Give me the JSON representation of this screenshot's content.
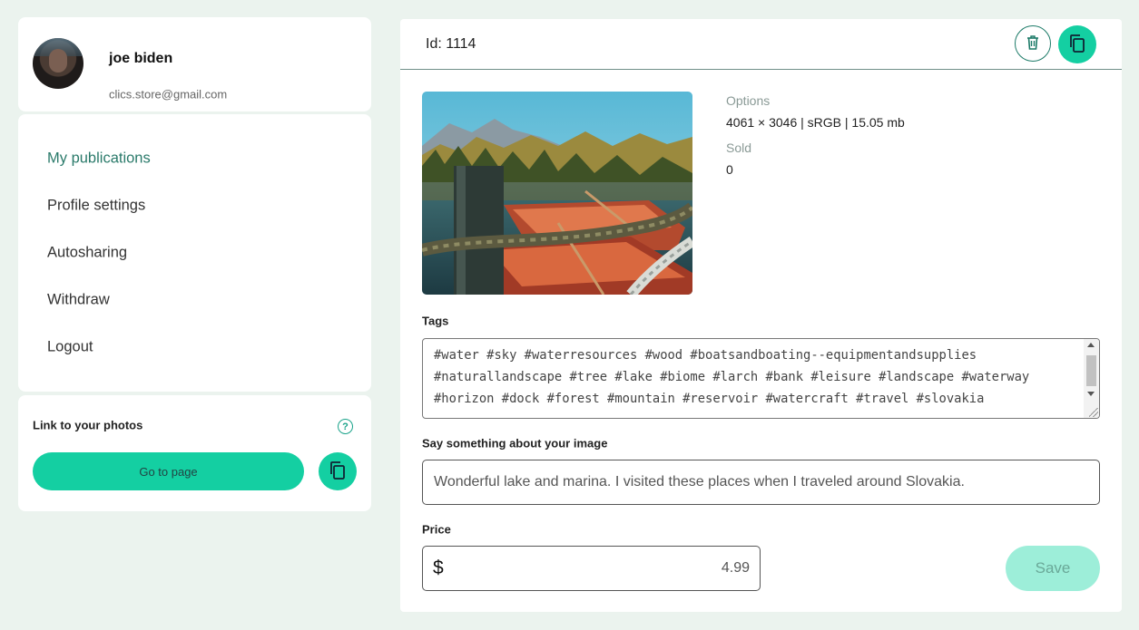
{
  "profile": {
    "name": "joe biden",
    "email": "clics.store@gmail.com"
  },
  "nav": {
    "items": [
      {
        "label": "My publications",
        "active": true
      },
      {
        "label": "Profile settings",
        "active": false
      },
      {
        "label": "Autosharing",
        "active": false
      },
      {
        "label": "Withdraw",
        "active": false
      },
      {
        "label": "Logout",
        "active": false
      }
    ]
  },
  "link_card": {
    "title": "Link to your photos",
    "help_icon": "?",
    "go_button": "Go to page",
    "copy_icon": "copy-icon"
  },
  "publication": {
    "id_label": "Id: 1114",
    "actions": {
      "delete_icon": "trash-icon",
      "duplicate_icon": "copy-icon"
    },
    "options_label": "Options",
    "options_value": "4061 × 3046 | sRGB | 15.05 mb",
    "sold_label": "Sold",
    "sold_value": "0",
    "tags_label": "Tags",
    "tags_lines": [
      "#water #sky #waterresources #wood #boatsandboating--equipmentandsupplies",
      "#naturallandscape #tree #lake #biome #larch #bank #leisure #landscape #waterway",
      "#horizon #dock #forest #mountain #reservoir #watercraft #travel #slovakia"
    ],
    "description_label": "Say something about your image",
    "description_value": "Wonderful lake and marina. I visited these places when I traveled around Slovakia.",
    "price_label": "Price",
    "currency": "$",
    "price_value": "4.99",
    "save_button": "Save"
  },
  "colors": {
    "accent": "#14cfa2",
    "accent_light": "#9deed9",
    "active_nav": "#2a7a6a",
    "background": "#ebf3ee"
  }
}
